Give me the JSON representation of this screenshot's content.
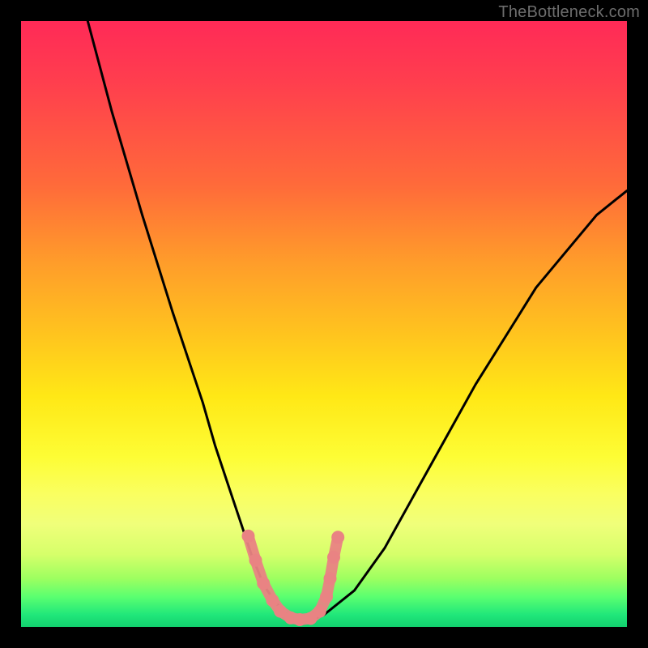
{
  "watermark": "TheBottleneck.com",
  "colors": {
    "frame": "#000000",
    "curve": "#000000",
    "marker": "#e98383"
  },
  "chart_data": {
    "type": "line",
    "title": "",
    "xlabel": "",
    "ylabel": "",
    "xlim": [
      0,
      100
    ],
    "ylim": [
      0,
      100
    ],
    "grid": false,
    "legend": false,
    "series": [
      {
        "name": "bottleneck-curve",
        "x": [
          11,
          15,
          20,
          25,
          30,
          32,
          34,
          36,
          38,
          40,
          42,
          44,
          46,
          48,
          50,
          55,
          60,
          65,
          70,
          75,
          80,
          85,
          90,
          95,
          100
        ],
        "y": [
          100,
          85,
          68,
          52,
          37,
          30,
          24,
          18,
          12,
          7,
          4,
          2,
          1.2,
          1.2,
          2,
          6,
          13,
          22,
          31,
          40,
          48,
          56,
          62,
          68,
          72
        ]
      }
    ],
    "markers": [
      {
        "name": "valley-highlight",
        "x": [
          37.5,
          38.7,
          40.0,
          41.5,
          42.8,
          44.5,
          46.0,
          47.8,
          49.3,
          50.4,
          51.0,
          51.6,
          52.3
        ],
        "y": [
          15.0,
          11.0,
          7.2,
          4.4,
          2.6,
          1.5,
          1.2,
          1.4,
          2.6,
          5.0,
          8.0,
          11.5,
          14.8
        ]
      }
    ]
  }
}
